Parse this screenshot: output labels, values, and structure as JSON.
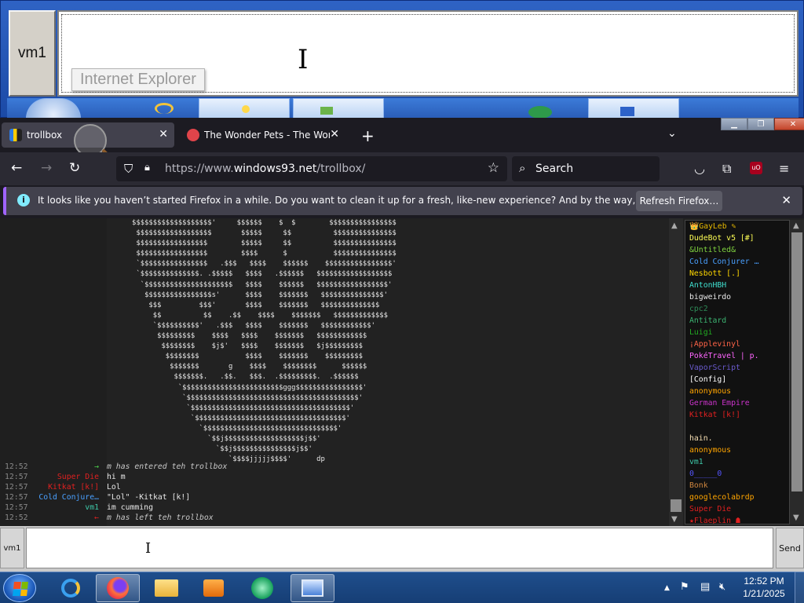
{
  "legacy_window": {
    "vm_label": "vm1",
    "tooltip": "Internet Explorer"
  },
  "browser": {
    "tabs": [
      {
        "title": "trollbox",
        "active": true
      },
      {
        "title": "The Wonder Pets - The Wonder",
        "active": false
      }
    ],
    "url_prefix": "https://www.",
    "url_domain": "windows93.net",
    "url_path": "/trollbox/",
    "search_placeholder": "Search",
    "notification": {
      "message": "It looks like you haven’t started Firefox in a while. Do you want to clean it up for a fresh, like-new experience? And by the way, welcome back!",
      "button": "Refresh Firefox…"
    }
  },
  "trollbox": {
    "ascii_art": [
      "      $$$$$$$$$$$$$$$$$$$'     $$$$$$    $  $        $$$$$$$$$$$$$$$$",
      "       $$$$$$$$$$$$$$$$$$       $$$$$     $$          $$$$$$$$$$$$$$$",
      "       $$$$$$$$$$$$$$$$$        $$$$$     $$          $$$$$$$$$$$$$$$",
      "       $$$$$$$$$$$$$$$$$        $$$$      $           $$$$$$$$$$$$$$$",
      "       `$$$$$$$$$$$$$$$$   .$$$   $$$$    $$$$$$    $$$$$$$$$$$$$$$$'",
      "       `$$$$$$$$$$$$$$. .$$$$$   $$$$   .$$$$$$   $$$$$$$$$$$$$$$$$$",
      "        `$$$$$$$$$$$$$$$$$$$$$   $$$$    $$$$$$   $$$$$$$$$$$$$$$$$'",
      "         $$$$$$$$$$$$$$$$s'      $$$$    $$$$$$$   $$$$$$$$$$$$$$$'",
      "          $$$         $$$'       $$$$    $$$$$$$   $$$$$$$$$$$$$$",
      "           $$          $$    .$$    $$$$    $$$$$$$   $$$$$$$$$$$$$",
      "           `$$$$$$$$$$'   .$$$   $$$$    $$$$$$$   $$$$$$$$$$$$'",
      "            $$$$$$$$$    $$$$   $$$$    $$$$$$$   $$$$$$$$$$$$",
      "             $$$$$$$$    $j$'   $$$$    $$$$$$$   $j$$$$$$$$$",
      "              $$$$$$$$           $$$$    $$$$$$$    $$$$$$$$$",
      "               $$$$$$$       g    $$$$    $$$$$$$$      $$$$$$",
      "                $$$$$$$.   .$$.   $$$.  .$$$$$$$$$.  .$$$$$$",
      "                 `$$$$$$$$$$$$$$$$$$$$$$$$ggg$$$$$$$$$$$$$$$$'",
      "                  `$$$$$$$$$$$$$$$$$$$$$$$$$$$$$$$$$$$$$$$$$'",
      "                   `$$$$$$$$$$$$$$$$$$$$$$$$$$$$$$$$$$$$$$'",
      "                    `$$$$$$$$$$$$$$$$$$$$$$$$$$$$$$$$$$$$'",
      "                      `$$$$$$$$$$$$$$$$$$$$$$$$$$$$$$$$'",
      "                        `$$j$$$$$$$$$$$$$$$$$$$j$$'",
      "                          `$$j$$$$$$$$$$$$$$$j$$'",
      "                             `$$$$jjjjj$$$$'      dp"
    ],
    "messages": [
      {
        "time": "12:52",
        "nick": "→",
        "nick_color": "#4cd34c",
        "text": "m has entered teh trollbox",
        "system": true
      },
      {
        "time": "12:57",
        "nick": "Super Die",
        "nick_color": "#e02020",
        "text": "hi m",
        "system": false
      },
      {
        "time": "12:57",
        "nick": "Kitkat [k!]",
        "nick_color": "#e02020",
        "text": "Lol",
        "system": false
      },
      {
        "time": "12:57",
        "nick": "Cold Conjure…",
        "nick_color": "#4aa0ff",
        "text": "\"Lol\" -Kitkat [k!]",
        "system": false
      },
      {
        "time": "12:57",
        "nick": "vm1",
        "nick_color": "#3ec8a8",
        "text": "im cumming",
        "system": false
      },
      {
        "time": "12:52",
        "nick": "←",
        "nick_color": "#e02020",
        "text": "m has left teh trollbox",
        "system": true
      }
    ],
    "users": [
      {
        "name": "👑GayLeb ✎",
        "color": "#e6b800"
      },
      {
        "name": "DudeBot v5 [#]",
        "color": "#ffff55"
      },
      {
        "name": "&Untitled&",
        "color": "#7fd23f"
      },
      {
        "name": "Cold Conjurer …",
        "color": "#4aa0ff"
      },
      {
        "name": "Nesbott [.]",
        "color": "#ffd700"
      },
      {
        "name": "AntonHBH",
        "color": "#40e0d0"
      },
      {
        "name": "bigweirdo",
        "color": "#e8e8e8"
      },
      {
        "name": "cpc2",
        "color": "#2e8b57"
      },
      {
        "name": "Antitard",
        "color": "#3cb371"
      },
      {
        "name": "Luigi",
        "color": "#22aa22"
      },
      {
        "name": "¡Applevinyl",
        "color": "#ff6347"
      },
      {
        "name": "PokéTravel | p.",
        "color": "#ff66ff"
      },
      {
        "name": "VaporScript",
        "color": "#6a5acd"
      },
      {
        "name": "[Config]",
        "color": "#ffffff"
      },
      {
        "name": "anonymous",
        "color": "#ffa500"
      },
      {
        "name": "German Empire",
        "color": "#cc33cc"
      },
      {
        "name": "Kitkat [k!]",
        "color": "#e02020"
      },
      {
        "name": "",
        "color": "#7a0000"
      },
      {
        "name": "hain.",
        "color": "#f5deb3"
      },
      {
        "name": "anonymous",
        "color": "#ffa500"
      },
      {
        "name": "vm1",
        "color": "#3ec8a8"
      },
      {
        "name": "0_____0",
        "color": "#5555ff"
      },
      {
        "name": "Bonk",
        "color": "#cd853f"
      },
      {
        "name": "googlecolabrdp",
        "color": "#ffa500"
      },
      {
        "name": "Super Die",
        "color": "#e02020"
      },
      {
        "name": "★Flaeplin ☗",
        "color": "#e02020"
      }
    ],
    "input_nick": "vm1",
    "send_label": "Send"
  },
  "taskbar": {
    "time": "12:52 PM",
    "date": "1/21/2025"
  },
  "colors": {
    "firefox_dark": "#1c1b22",
    "firefox_toolbar": "#2b2a33",
    "notice_accent": "#a064ff",
    "taskbar": "#1f4e8c"
  }
}
